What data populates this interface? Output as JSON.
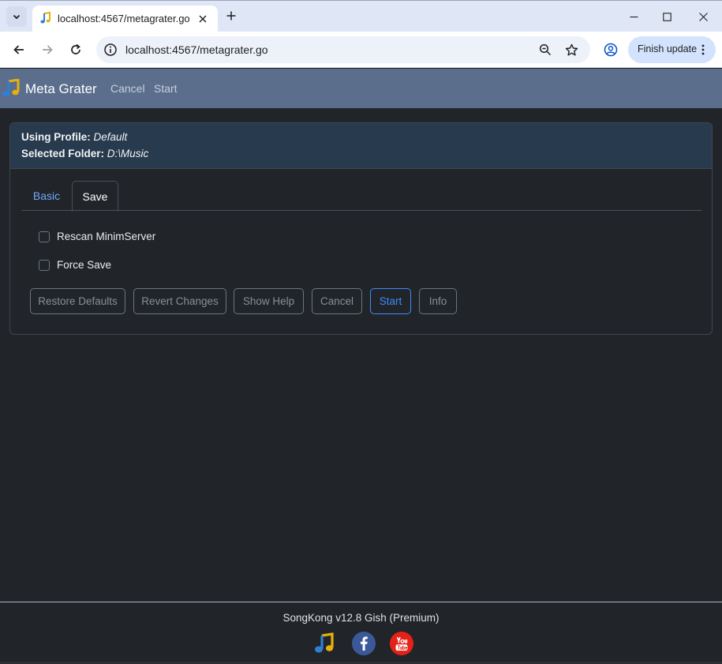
{
  "browser": {
    "tab_title": "localhost:4567/metagrater.go",
    "url": "localhost:4567/metagrater.go",
    "update_button_label": "Finish update",
    "icons": [
      "tab-search-icon",
      "music-favicon-icon",
      "close-icon",
      "plus-icon",
      "minimize-icon",
      "maximize-icon",
      "close-window-icon",
      "back-icon",
      "forward-icon",
      "reload-icon",
      "site-info-icon",
      "zoom-icon",
      "bookmark-star-icon",
      "profile-icon",
      "more-vert-icon"
    ]
  },
  "navbar": {
    "brand": "Meta Grater",
    "links": [
      "Cancel",
      "Start"
    ],
    "background": "#5b6e8c"
  },
  "info": {
    "profile_label": "Using Profile:",
    "profile_value": "Default",
    "folder_label": "Selected Folder:",
    "folder_value": "D:\\Music"
  },
  "tabs": {
    "items": [
      "Basic",
      "Save"
    ],
    "active": "Save"
  },
  "options": [
    {
      "label": "Rescan MinimServer",
      "checked": false
    },
    {
      "label": "Force Save",
      "checked": false
    }
  ],
  "buttons": {
    "restore_defaults": "Restore Defaults",
    "revert_changes": "Revert Changes",
    "show_help": "Show Help",
    "cancel": "Cancel",
    "start": "Start",
    "info": "Info"
  },
  "footer": {
    "version_text": "SongKong v12.8 Gish (Premium)",
    "icons": [
      "songkong-icon",
      "facebook-icon",
      "youtube-icon"
    ]
  },
  "colors": {
    "page_background": "#212529",
    "header_background": "#283a4d",
    "accent": "#3d8bfd",
    "active_tab_text": "#6ea8fe"
  }
}
